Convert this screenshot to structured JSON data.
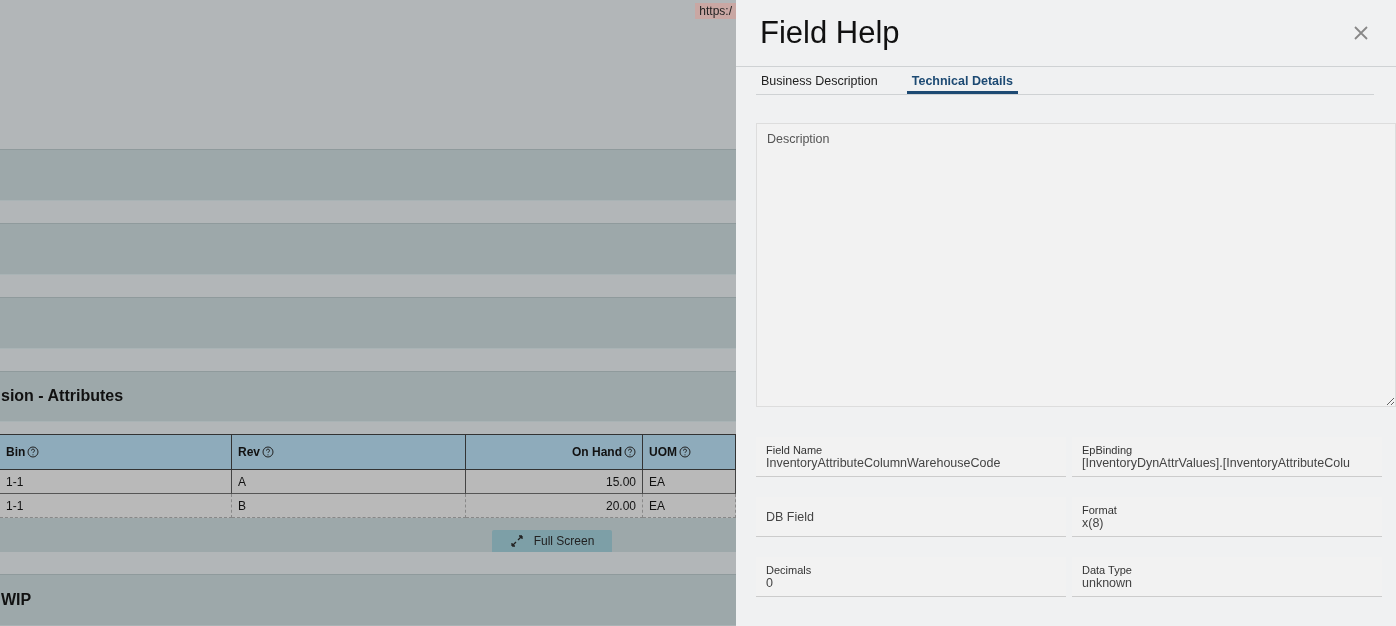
{
  "background": {
    "url_tag": "https:/",
    "section_title": "sion - Attributes",
    "grid": {
      "columns": [
        {
          "label": "Bin",
          "kind": "text"
        },
        {
          "label": "Rev",
          "kind": "text"
        },
        {
          "label": "On Hand",
          "kind": "number"
        },
        {
          "label": "UOM",
          "kind": "text"
        }
      ],
      "rows": [
        [
          "1-1",
          "A",
          "15.00",
          "EA"
        ],
        [
          "1-1",
          "B",
          "20.00",
          "EA"
        ]
      ]
    },
    "full_screen_button": "Full Screen",
    "section_title_2": "WIP"
  },
  "panel": {
    "title": "Field Help",
    "tabs": [
      {
        "label": "Business Description",
        "selected": false
      },
      {
        "label": "Technical Details",
        "selected": true
      }
    ],
    "description": {
      "placeholder": "Description"
    },
    "fields": [
      {
        "label": "Field Name",
        "value": "InventoryAttributeColumnWarehouseCode"
      },
      {
        "label": "EpBinding",
        "value": "[InventoryDynAttrValues].[InventoryAttributeColu"
      },
      {
        "placeholder": "DB Field"
      },
      {
        "label": "Format",
        "value": "x(8)"
      },
      {
        "label": "Decimals",
        "value": "0"
      },
      {
        "label": "Data Type",
        "value": "unknown"
      }
    ]
  }
}
